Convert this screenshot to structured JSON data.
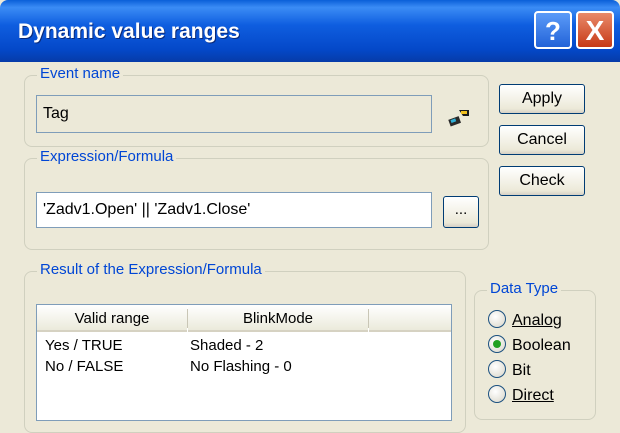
{
  "window": {
    "title": "Dynamic value ranges"
  },
  "titlebar_buttons": {
    "help": "?",
    "close": "X"
  },
  "event_name": {
    "group_label": "Event name",
    "value": "Tag"
  },
  "expression": {
    "group_label": "Expression/Formula",
    "value": "'Zadv1.Open' || 'Zadv1.Close'",
    "browse_label": "..."
  },
  "buttons": {
    "apply": "Apply",
    "cancel": "Cancel",
    "check": "Check"
  },
  "result": {
    "group_label": "Result of the Expression/Formula",
    "columns": [
      "Valid range",
      "BlinkMode"
    ],
    "rows": [
      [
        "Yes / TRUE",
        "Shaded - 2"
      ],
      [
        "No / FALSE",
        "No Flashing - 0"
      ]
    ]
  },
  "data_type": {
    "group_label": "Data Type",
    "options": [
      "Analog",
      "Boolean",
      "Bit",
      "Direct"
    ],
    "selected": "Boolean"
  }
}
